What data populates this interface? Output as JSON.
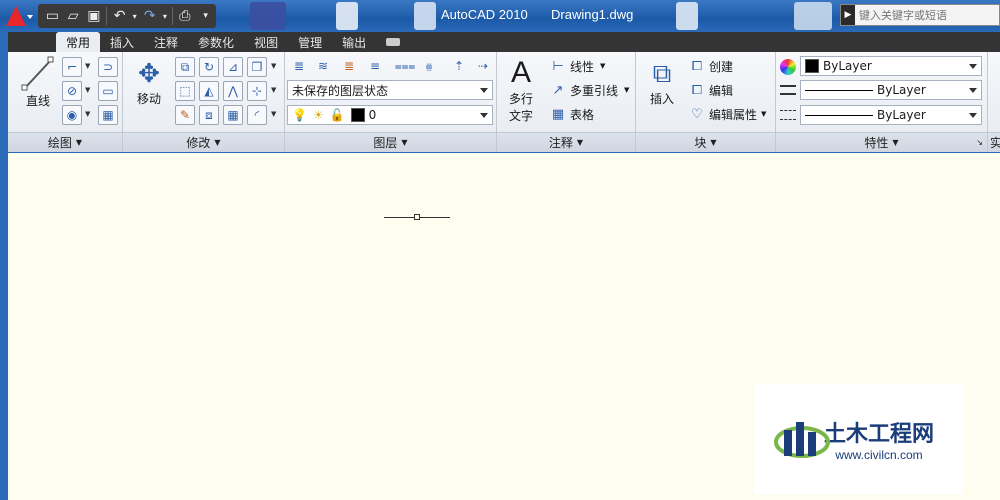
{
  "window": {
    "app_title": "AutoCAD 2010",
    "file_title": "Drawing1.dwg"
  },
  "search": {
    "placeholder": "键入关键字或短语"
  },
  "tabs": [
    "常用",
    "插入",
    "注释",
    "参数化",
    "视图",
    "管理",
    "输出"
  ],
  "ribbon": {
    "draw": {
      "title": "绘图",
      "line_label": "直线"
    },
    "modify": {
      "title": "修改",
      "move_label": "移动"
    },
    "layers": {
      "title": "图层",
      "state_value": "未保存的图层状态",
      "layer_value": "0"
    },
    "annotation": {
      "title": "注释",
      "text_label_1": "多行",
      "text_label_2": "文字",
      "linear_label": "线性",
      "mleader_label": "多重引线",
      "table_label": "表格"
    },
    "block": {
      "title": "块",
      "insert_label": "插入",
      "create_label": "创建",
      "edit_label": "编辑",
      "edit_attr_label": "编辑属性"
    },
    "properties": {
      "title": "特性",
      "color_value": "ByLayer",
      "linetype_value": "ByLayer",
      "lineweight_value": "ByLayer"
    },
    "next_panel_partial": "实"
  },
  "watermark": {
    "title": "土木工程网",
    "url": "www.civilcn.com"
  },
  "colors": {
    "titlebar": "#2a6ab8",
    "canvas": "#fffdf0",
    "tabbar": "#343434",
    "autocad_logo": "#e8262b"
  }
}
